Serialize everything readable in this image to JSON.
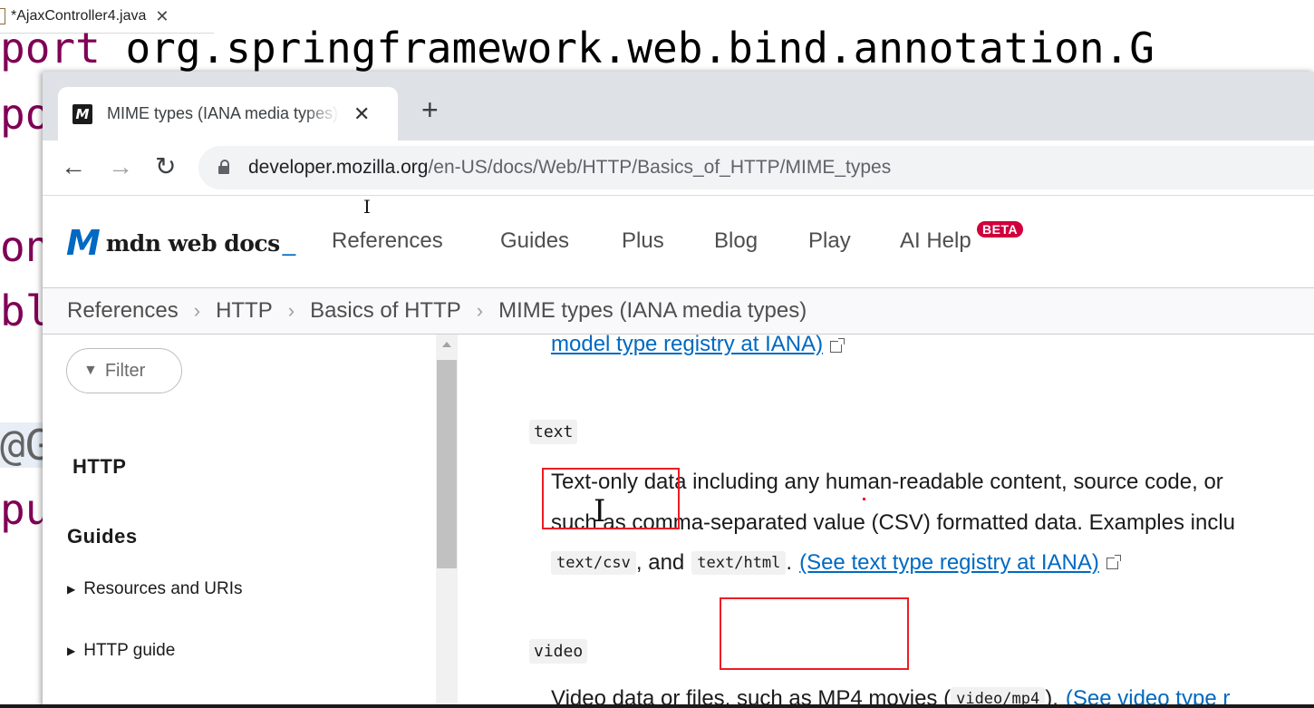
{
  "editor": {
    "tab_label": "*AjaxController4.java",
    "tab_close": "✕",
    "code_line_1": "port org.springframework.web.bind.annotation.G",
    "fragments": [
      "po",
      "on",
      "bl",
      "@G",
      "pu"
    ]
  },
  "browser": {
    "tab_title": "MIME types (IANA media types)",
    "favicon": "M",
    "tab_close": "✕",
    "new_tab": "+",
    "back": "←",
    "forward": "→",
    "reload": "↻",
    "url_host": "developer.mozilla.org",
    "url_path": "/en-US/docs/Web/HTTP/Basics_of_HTTP/MIME_types"
  },
  "mdn": {
    "logo_mark": "M",
    "logo_text": "mdn web docs",
    "logo_cursor": "_",
    "nav": {
      "references": "References",
      "guides": "Guides",
      "plus": "Plus",
      "blog": "Blog",
      "play": "Play",
      "ai_help": "AI Help",
      "beta": "BETA"
    },
    "breadcrumbs": [
      "References",
      "HTTP",
      "Basics of HTTP",
      "MIME types (IANA media types)"
    ],
    "breadcrumb_sep": "›",
    "sidebar": {
      "filter_placeholder": "Filter",
      "filter_icon": "▼",
      "http_heading": "HTTP",
      "guides_heading": "Guides",
      "items": [
        "Resources and URIs",
        "HTTP guide"
      ],
      "expand_glyph": "▶"
    },
    "content": {
      "model_link": "model type registry at IANA)",
      "text_term": "text",
      "text_desc_1": "Text-only data including any human-readable content, source code, or",
      "text_desc_2": "such as comma-separated value (CSV) formatted data. Examples inclu",
      "code_csv": "text/csv",
      "sep_and": ", and",
      "code_html": "text/html",
      "period": ".",
      "text_link": "(See text type registry at IANA)",
      "video_term": "video",
      "video_desc_start": "Video data or files, such as MP4 movies (",
      "code_mp4": "video/mp4",
      "video_desc_mid": ").",
      "video_link": "(See video type r"
    }
  },
  "cursor_glyph": "I",
  "colors": {
    "mdn_blue": "#0069c2",
    "annotation_red": "#ee1c24",
    "eclipse_keyword": "#7f0055",
    "beta_badge": "#d1003c"
  }
}
